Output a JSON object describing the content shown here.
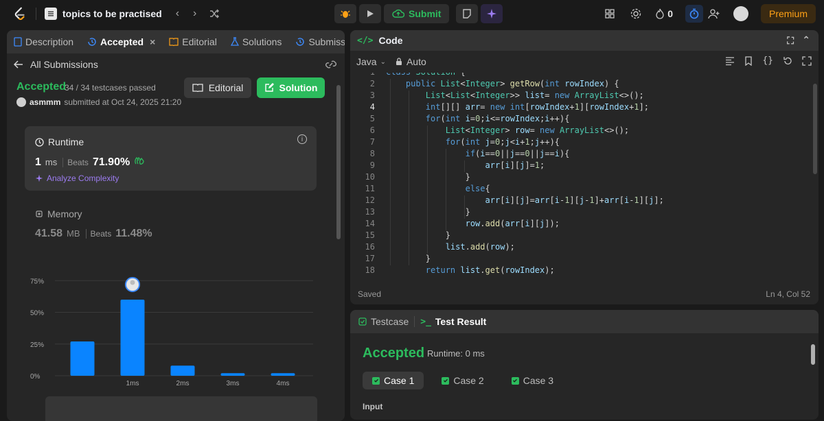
{
  "topbar": {
    "problem_list_title": "topics to be practised",
    "submit_label": "Submit",
    "streak_count": "0",
    "premium_label": "Premium"
  },
  "left": {
    "tabs": [
      {
        "label": "Description"
      },
      {
        "label": "Accepted"
      },
      {
        "label": "Editorial"
      },
      {
        "label": "Solutions"
      },
      {
        "label": "Submission"
      }
    ],
    "all_submissions": "All Submissions",
    "status": "Accepted",
    "testcases": "34 / 34 testcases passed",
    "username": "asmmm",
    "submitted_at": "submitted at Oct 24, 2025 21:20",
    "editorial_button": "Editorial",
    "solution_button": "Solution",
    "runtime": {
      "label": "Runtime",
      "value": "1",
      "unit": "ms",
      "beats_label": "Beats",
      "beats_pct": "71.90%",
      "analyze": "Analyze Complexity"
    },
    "memory": {
      "label": "Memory",
      "value": "41.58",
      "unit": "MB",
      "beats_label": "Beats",
      "beats_pct": "11.48%"
    }
  },
  "chart_data": {
    "type": "bar",
    "categories": [
      "",
      "1ms",
      "2ms",
      "3ms",
      "4ms"
    ],
    "values": [
      27,
      60,
      8,
      2,
      2
    ],
    "ytick_labels": [
      "0%",
      "25%",
      "50%",
      "75%"
    ],
    "yticks": [
      0,
      25,
      50,
      75
    ],
    "ylim": [
      0,
      80
    ],
    "highlight_index": 1,
    "bar_color": "#0a84ff"
  },
  "code": {
    "title": "Code",
    "language": "Java",
    "mode": "Auto",
    "saved": "Saved",
    "cursor": "Ln 4, Col 52",
    "lines": [
      {
        "n": "1",
        "text": "class Solution {"
      },
      {
        "n": "2",
        "text": "    public List<Integer> getRow(int rowIndex) {"
      },
      {
        "n": "3",
        "text": "        List<List<Integer>> list= new ArrayList<>();"
      },
      {
        "n": "4",
        "text": "        int[][] arr= new int[rowIndex+1][rowIndex+1];"
      },
      {
        "n": "5",
        "text": "        for(int i=0;i<=rowIndex;i++){"
      },
      {
        "n": "6",
        "text": "            List<Integer> row= new ArrayList<>();"
      },
      {
        "n": "7",
        "text": "            for(int j=0;j<i+1;j++){"
      },
      {
        "n": "8",
        "text": "                if(i==0||j==0||j==i){"
      },
      {
        "n": "9",
        "text": "                    arr[i][j]=1;"
      },
      {
        "n": "10",
        "text": "                }"
      },
      {
        "n": "11",
        "text": "                else{"
      },
      {
        "n": "12",
        "text": "                    arr[i][j]=arr[i-1][j-1]+arr[i-1][j];"
      },
      {
        "n": "13",
        "text": "                }"
      },
      {
        "n": "14",
        "text": "                row.add(arr[i][j]);"
      },
      {
        "n": "15",
        "text": "            }"
      },
      {
        "n": "16",
        "text": "            list.add(row);"
      },
      {
        "n": "17",
        "text": "        }"
      },
      {
        "n": "18",
        "text": "        return list.get(rowIndex);"
      }
    ]
  },
  "result": {
    "tab_testcase": "Testcase",
    "tab_result": "Test Result",
    "status": "Accepted",
    "runtime": "Runtime: 0 ms",
    "cases": [
      "Case 1",
      "Case 2",
      "Case 3"
    ],
    "input_label": "Input"
  }
}
